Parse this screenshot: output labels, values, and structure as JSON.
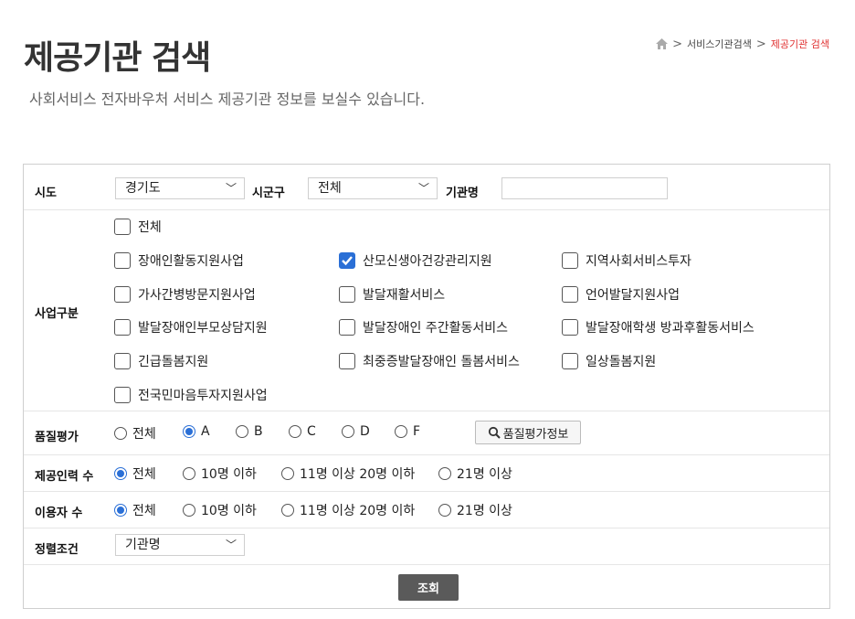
{
  "header": {
    "title": "제공기관 검색",
    "subtitle": "사회서비스 전자바우처 서비스 제공기관 정보를 보실수 있습니다."
  },
  "breadcrumb": {
    "items": [
      "서비스기관검색",
      "제공기관 검색"
    ],
    "separator": ">"
  },
  "form": {
    "sido": {
      "label": "시도",
      "value": "경기도"
    },
    "sigungu": {
      "label": "시군구",
      "value": "전체"
    },
    "agency_name": {
      "label": "기관명",
      "value": ""
    },
    "business": {
      "label": "사업구분",
      "options": [
        {
          "label": "전체",
          "checked": false
        },
        {
          "label": "장애인활동지원사업",
          "checked": false
        },
        {
          "label": "산모신생아건강관리지원",
          "checked": true
        },
        {
          "label": "지역사회서비스투자",
          "checked": false
        },
        {
          "label": "가사간병방문지원사업",
          "checked": false
        },
        {
          "label": "발달재활서비스",
          "checked": false
        },
        {
          "label": "언어발달지원사업",
          "checked": false
        },
        {
          "label": "발달장애인부모상담지원",
          "checked": false
        },
        {
          "label": "발달장애인 주간활동서비스",
          "checked": false
        },
        {
          "label": "발달장애학생 방과후활동서비스",
          "checked": false
        },
        {
          "label": "긴급돌봄지원",
          "checked": false
        },
        {
          "label": "최중증발달장애인 돌봄서비스",
          "checked": false
        },
        {
          "label": "일상돌봄지원",
          "checked": false
        },
        {
          "label": "전국민마음투자지원사업",
          "checked": false
        }
      ]
    },
    "quality": {
      "label": "품질평가",
      "options": [
        "전체",
        "A",
        "B",
        "C",
        "D",
        "F"
      ],
      "selected": "A",
      "info_button": "품질평가정보"
    },
    "staff": {
      "label": "제공인력 수",
      "options": [
        "전체",
        "10명 이하",
        "11명 이상 20명 이하",
        "21명 이상"
      ],
      "selected": "전체"
    },
    "users": {
      "label": "이용자 수",
      "options": [
        "전체",
        "10명 이하",
        "11명 이상 20명 이하",
        "21명 이상"
      ],
      "selected": "전체"
    },
    "sort": {
      "label": "정렬조건",
      "value": "기관명"
    },
    "submit_label": "조회"
  },
  "colors": {
    "accent": "#2a6fd6",
    "breadcrumb_current": "#e03030",
    "submit_bg": "#5a5a5a"
  },
  "icons": [
    "home-icon",
    "chevron-down-icon",
    "search-icon",
    "check-icon"
  ]
}
